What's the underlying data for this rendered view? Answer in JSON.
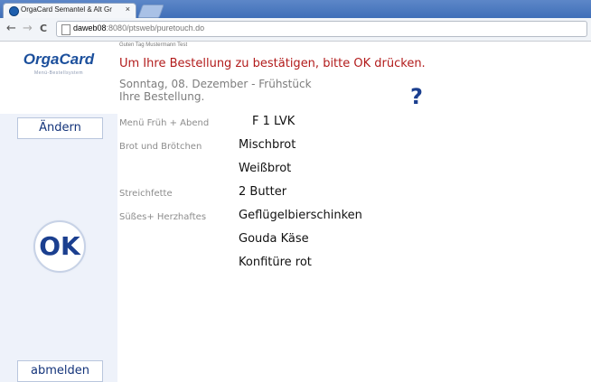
{
  "browser": {
    "tab_title": "OrgaCard Semantel & Alt Gr",
    "tab_close": "×",
    "back": "←",
    "forward": "→",
    "reload": "C",
    "url_host": "daweb08",
    "url_rest": ":8080/ptsweb/puretouch.do"
  },
  "sidebar": {
    "logo": "OrgaCard",
    "logo_sub": "Menü-Bestellsystem",
    "change_label": "Ändern",
    "ok_label": "OK",
    "logout_label": "abmelden"
  },
  "header": {
    "greeting": "Guten Tag Mustermann Test",
    "instruction": "Um Ihre Bestellung zu bestätigen, bitte OK drücken.",
    "date_meal": "Sonntag, 08. Dezember - Frühstück",
    "order_title": "Ihre Bestellung.",
    "help": "?"
  },
  "order": {
    "rows": [
      {
        "category": "Menü Früh + Abend",
        "value": "F 1 LVK"
      },
      {
        "category": "Brot und Brötchen",
        "value": "Mischbrot"
      },
      {
        "category": "",
        "value": "Weißbrot"
      },
      {
        "category": "Streichfette",
        "value": "2 Butter"
      },
      {
        "category": "Süßes+ Herzhaftes",
        "value": "Geflügelbierschinken"
      },
      {
        "category": "",
        "value": "Gouda Käse"
      },
      {
        "category": "",
        "value": "Konfitüre rot"
      }
    ]
  },
  "colors": {
    "accent_red": "#b21b1b",
    "brand_blue": "#1b3f8f",
    "sidebar_bg": "#eef2fa"
  }
}
